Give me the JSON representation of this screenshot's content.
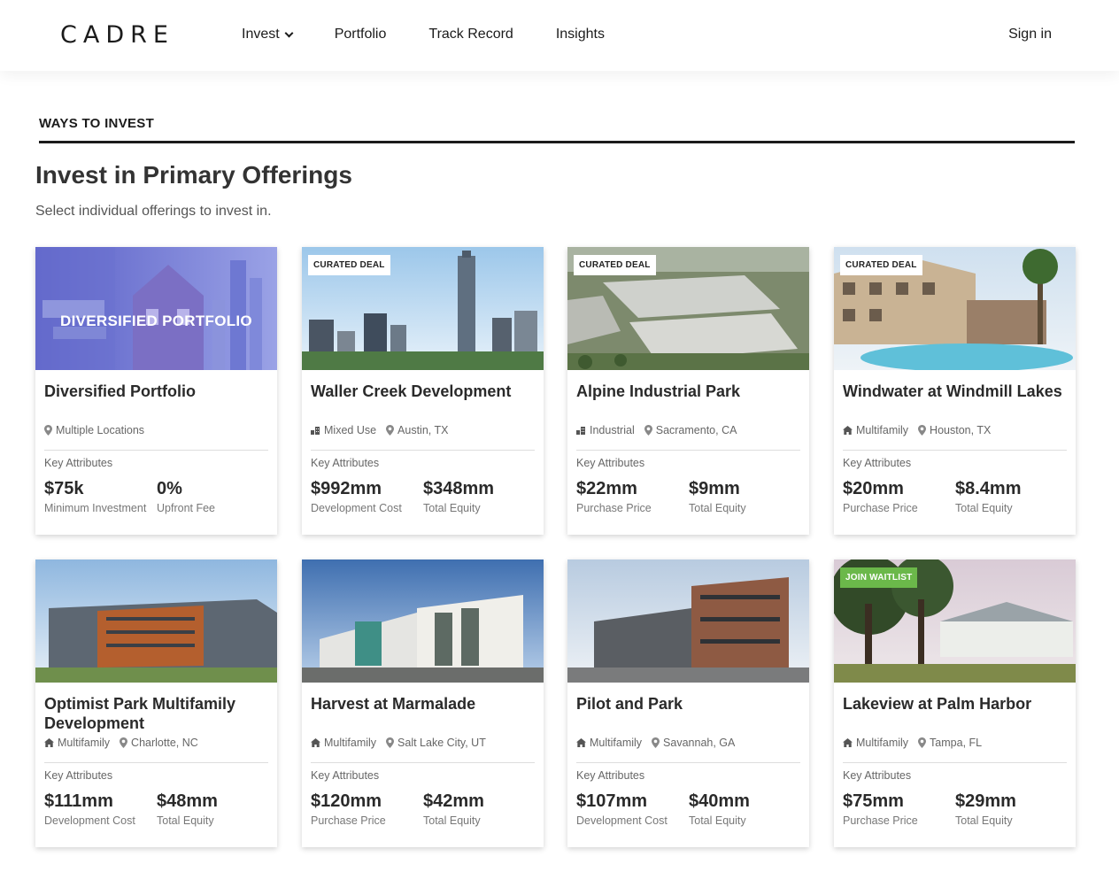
{
  "header": {
    "logo": "CADRE",
    "nav": [
      "Invest",
      "Portfolio",
      "Track Record",
      "Insights"
    ],
    "signin": "Sign in"
  },
  "section": {
    "label": "WAYS TO INVEST",
    "title": "Invest in Primary Offerings",
    "subtitle": "Select individual offerings to invest in."
  },
  "key_attributes_label": "Key Attributes",
  "cards": [
    {
      "title": "Diversified Portfolio",
      "badge": "",
      "overlay": "DIVERSIFIED PORTFOLIO",
      "type": "",
      "location": "Multiple Locations",
      "stat1_value": "$75k",
      "stat1_label": "Minimum Investment",
      "stat2_value": "0%",
      "stat2_label": "Upfront Fee"
    },
    {
      "title": "Waller Creek Development",
      "badge": "CURATED DEAL",
      "overlay": "",
      "type": "Mixed Use",
      "location": "Austin, TX",
      "stat1_value": "$992mm",
      "stat1_label": "Development Cost",
      "stat2_value": "$348mm",
      "stat2_label": "Total Equity"
    },
    {
      "title": "Alpine Industrial Park",
      "badge": "CURATED DEAL",
      "overlay": "",
      "type": "Industrial",
      "location": "Sacramento, CA",
      "stat1_value": "$22mm",
      "stat1_label": "Purchase Price",
      "stat2_value": "$9mm",
      "stat2_label": "Total Equity"
    },
    {
      "title": "Windwater at Windmill Lakes",
      "badge": "CURATED DEAL",
      "overlay": "",
      "type": "Multifamily",
      "location": "Houston, TX",
      "stat1_value": "$20mm",
      "stat1_label": "Purchase Price",
      "stat2_value": "$8.4mm",
      "stat2_label": "Total Equity"
    },
    {
      "title": "Optimist Park Multifamily Development",
      "badge": "",
      "overlay": "",
      "type": "Multifamily",
      "location": "Charlotte, NC",
      "stat1_value": "$111mm",
      "stat1_label": "Development Cost",
      "stat2_value": "$48mm",
      "stat2_label": "Total Equity"
    },
    {
      "title": "Harvest at Marmalade",
      "badge": "",
      "overlay": "",
      "type": "Multifamily",
      "location": "Salt Lake City, UT",
      "stat1_value": "$120mm",
      "stat1_label": "Purchase Price",
      "stat2_value": "$42mm",
      "stat2_label": "Total Equity"
    },
    {
      "title": "Pilot and Park",
      "badge": "",
      "overlay": "",
      "type": "Multifamily",
      "location": "Savannah, GA",
      "stat1_value": "$107mm",
      "stat1_label": "Development Cost",
      "stat2_value": "$40mm",
      "stat2_label": "Total Equity"
    },
    {
      "title": "Lakeview at Palm Harbor",
      "badge": "JOIN WAITLIST",
      "overlay": "",
      "type": "Multifamily",
      "location": "Tampa, FL",
      "stat1_value": "$75mm",
      "stat1_label": "Purchase Price",
      "stat2_value": "$29mm",
      "stat2_label": "Total Equity"
    }
  ],
  "colors": {
    "waitlist_badge": "#6bb84a",
    "text_dark": "#2a2a2a",
    "rule": "#1b1b1b"
  }
}
